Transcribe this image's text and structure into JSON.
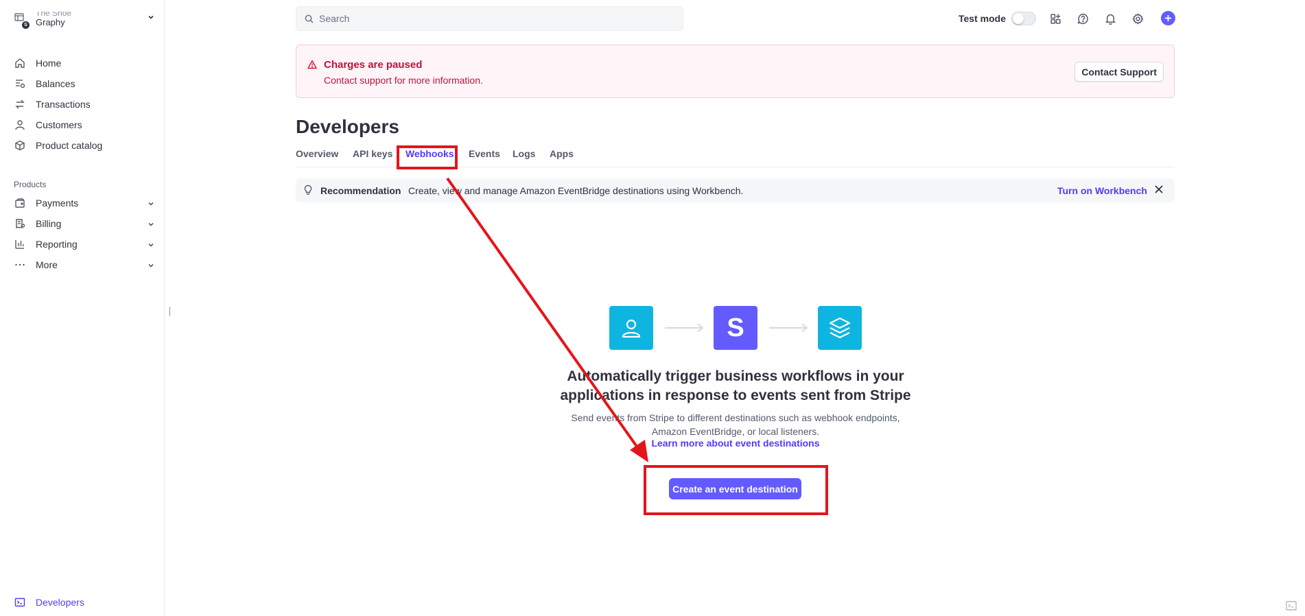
{
  "sidebar": {
    "account": {
      "name_line1": "The Shoe",
      "name_line2": "Graphy",
      "badge": "S"
    },
    "nav_items": [
      {
        "label": "Home",
        "icon": "home-icon"
      },
      {
        "label": "Balances",
        "icon": "balances-icon"
      },
      {
        "label": "Transactions",
        "icon": "transactions-icon"
      },
      {
        "label": "Customers",
        "icon": "customers-icon"
      },
      {
        "label": "Product catalog",
        "icon": "product-catalog-icon"
      }
    ],
    "products_label": "Products",
    "product_items": [
      {
        "label": "Payments",
        "icon": "payments-icon"
      },
      {
        "label": "Billing",
        "icon": "billing-icon"
      },
      {
        "label": "Reporting",
        "icon": "reporting-icon"
      },
      {
        "label": "More",
        "icon": "more-dots-icon"
      }
    ],
    "footer_item": {
      "label": "Developers",
      "icon": "terminal-icon"
    }
  },
  "topbar": {
    "search_placeholder": "Search",
    "test_mode_label": "Test mode",
    "test_mode_on": false
  },
  "alert": {
    "title": "Charges are paused",
    "text": "Contact support for more information.",
    "button": "Contact Support"
  },
  "page": {
    "title": "Developers",
    "tabs": [
      "Overview",
      "API keys",
      "Webhooks",
      "Events",
      "Logs",
      "Apps"
    ],
    "active_tab": "Webhooks"
  },
  "recommendation": {
    "title": "Recommendation",
    "text": "Create, view and manage Amazon EventBridge destinations using Workbench.",
    "link": "Turn on Workbench"
  },
  "empty_state": {
    "title": "Automatically trigger business workflows in your applications in response to events sent from Stripe",
    "subtitle": "Send events from Stripe to different destinations such as webhook endpoints, Amazon EventBridge, or local listeners.",
    "link": "Learn more about event destinations",
    "button": "Create an event destination",
    "stripe_letter": "S"
  },
  "colors": {
    "accent": "#635bff",
    "link": "#533afd",
    "danger": "#df1b41",
    "flow_cyan": "#0fb5e1",
    "annotation_red": "#e3151b"
  }
}
